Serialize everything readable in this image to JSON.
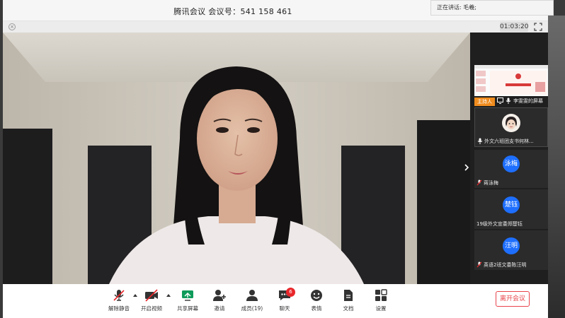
{
  "title": "腾讯会议  会议号：541 158 461",
  "timer": "01:03:20",
  "speaking": "正在讲话: 毛羲;",
  "sidebar": {
    "items": [
      {
        "name": "李雯雯的屏幕",
        "host": "主持人"
      },
      {
        "name": "外文六班团支书何林..."
      },
      {
        "name": "蒋泳梅",
        "avatar": "泳梅"
      },
      {
        "name": "19级外文宣委郑楚钰",
        "avatar": "楚钰"
      },
      {
        "name": "英语2班文委陈汪明",
        "avatar": "汪明"
      }
    ]
  },
  "toolbar": {
    "unmute": "解除静音",
    "video": "开启视频",
    "share": "共享屏幕",
    "invite": "邀请",
    "members": "成员(19)",
    "chat": "聊天",
    "chat_badge": "6",
    "emoji": "表情",
    "docs": "文档",
    "settings": "设置",
    "leave": "离开会议"
  },
  "colors": {
    "accent": "#1e6fff",
    "danger": "#e8434a",
    "host": "#f08c1e"
  }
}
